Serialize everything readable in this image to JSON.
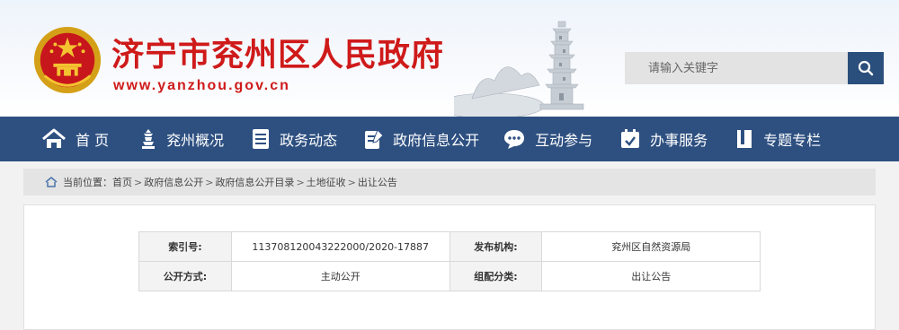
{
  "header": {
    "site_title": "济宁市兖州区人民政府",
    "site_url": "www.yanzhou.gov.cn",
    "brand_color": "#cf1a1a",
    "search_placeholder": "请输入关键字"
  },
  "nav": {
    "items": [
      {
        "label": "首 页",
        "icon": "home-icon"
      },
      {
        "label": "兖州概况",
        "icon": "pagoda-icon"
      },
      {
        "label": "政务动态",
        "icon": "document-list-icon"
      },
      {
        "label": "政府信息公开",
        "icon": "document-edit-icon"
      },
      {
        "label": "互动参与",
        "icon": "chat-bubble-icon"
      },
      {
        "label": "办事服务",
        "icon": "calendar-check-icon"
      },
      {
        "label": "专题专栏",
        "icon": "book-icon"
      }
    ],
    "bg_color": "#2e5081"
  },
  "breadcrumb": {
    "prefix": "当前位置：",
    "items": [
      "首页",
      "政府信息公开",
      "政府信息公开目录",
      "土地征收",
      "出让公告"
    ],
    "separator": ">"
  },
  "meta_table": {
    "rows": [
      {
        "label1": "索引号:",
        "value1": "11370812004322200​0/2020-17887",
        "label2": "发布机构:",
        "value2": "兖州区自然资源局"
      },
      {
        "label1": "公开方式:",
        "value1": "主动公开",
        "label2": "组配分类:",
        "value2": "出让公告"
      }
    ]
  }
}
